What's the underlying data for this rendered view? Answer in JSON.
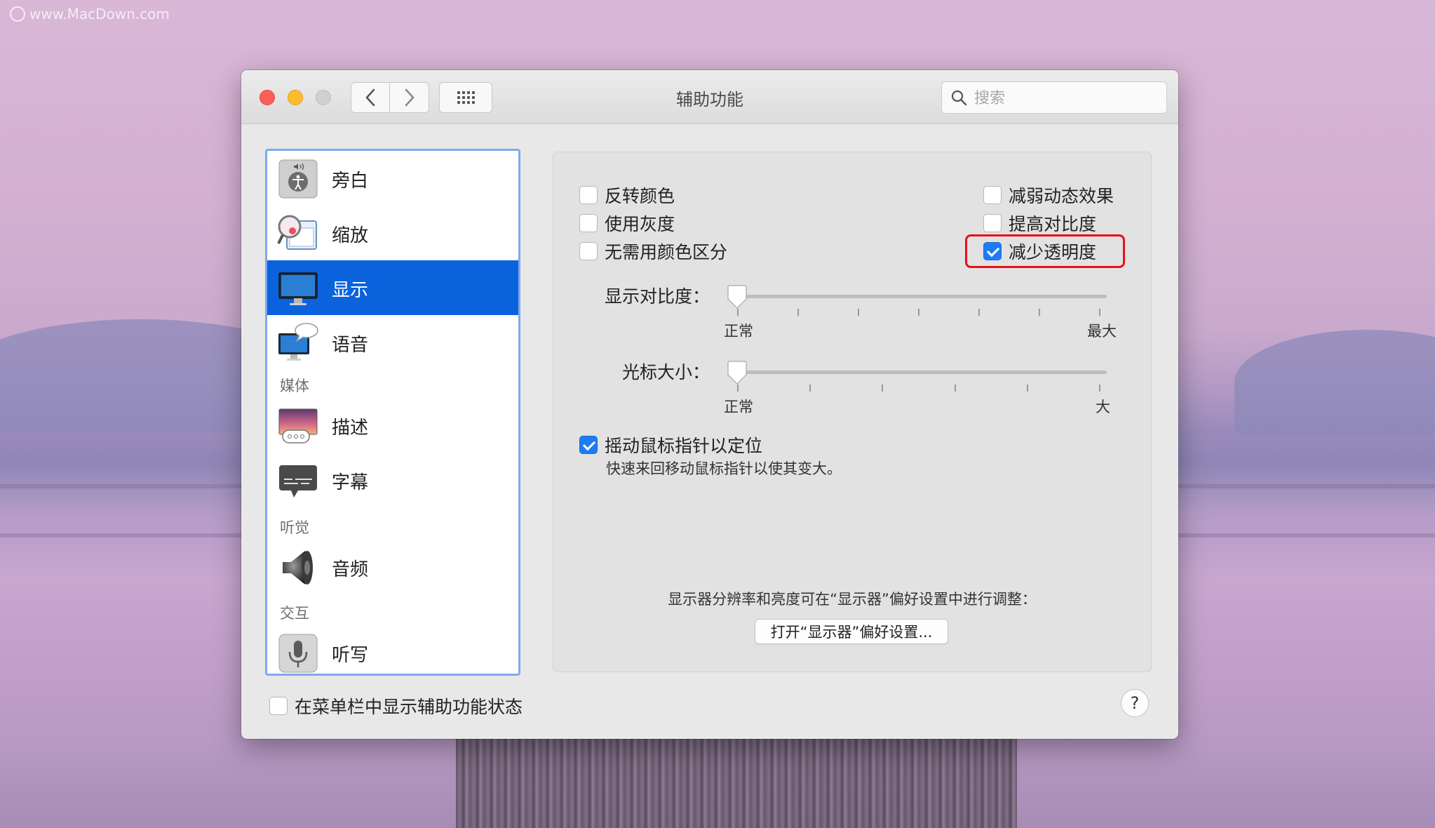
{
  "watermark": "www.MacDown.com",
  "window": {
    "title": "辅助功能",
    "search_placeholder": "搜索"
  },
  "sidebar": {
    "items": [
      {
        "label": "旁白",
        "icon": "voiceover-icon"
      },
      {
        "label": "缩放",
        "icon": "zoom-icon"
      },
      {
        "label": "显示",
        "icon": "display-icon",
        "selected": true
      },
      {
        "label": "语音",
        "icon": "speech-icon"
      },
      {
        "label": "描述",
        "icon": "descriptions-icon"
      },
      {
        "label": "字幕",
        "icon": "captions-icon"
      },
      {
        "label": "音频",
        "icon": "audio-icon"
      },
      {
        "label": "听写",
        "icon": "dictation-icon"
      }
    ],
    "sections": {
      "media": "媒体",
      "hearing": "听觉",
      "interaction": "交互"
    }
  },
  "options": {
    "invert_colors": {
      "label": "反转颜色",
      "checked": false
    },
    "use_grayscale": {
      "label": "使用灰度",
      "checked": false
    },
    "differentiate_without_color": {
      "label": "无需用颜色区分",
      "checked": false
    },
    "reduce_motion": {
      "label": "减弱动态效果",
      "checked": false
    },
    "increase_contrast": {
      "label": "提高对比度",
      "checked": false
    },
    "reduce_transparency": {
      "label": "减少透明度",
      "checked": true
    }
  },
  "contrast_slider": {
    "label": "显示对比度：",
    "min_label": "正常",
    "max_label": "最大",
    "value": 0
  },
  "cursor_slider": {
    "label": "光标大小：",
    "min_label": "正常",
    "max_label": "大",
    "value": 0
  },
  "shake_to_locate": {
    "label": "摇动鼠标指针以定位",
    "checked": true,
    "description": "快速来回移动鼠标指针以使其变大。"
  },
  "display_note": "显示器分辨率和亮度可在“显示器”偏好设置中进行调整：",
  "open_display_prefs_label": "打开“显示器”偏好设置...",
  "menubar_status": {
    "label": "在菜单栏中显示辅助功能状态",
    "checked": false
  },
  "help_label": "?",
  "colors": {
    "selection": "#0a63dc",
    "checkbox_on": "#1f7cf2",
    "highlight_box": "#e8101a"
  }
}
